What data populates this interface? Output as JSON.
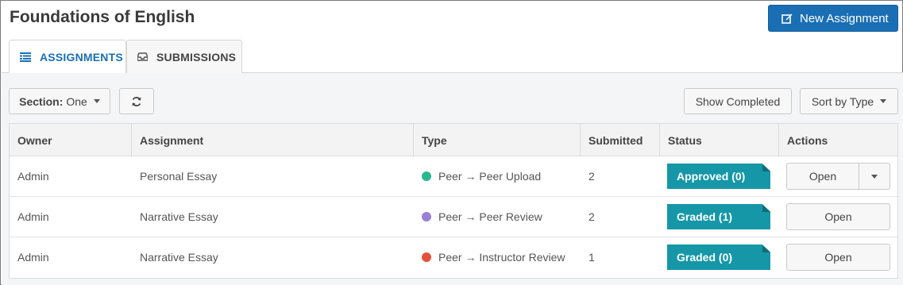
{
  "header": {
    "title": "Foundations of English",
    "new_button_label": "New Assignment"
  },
  "tabs": [
    {
      "label": "ASSIGNMENTS",
      "icon": "list-icon",
      "active": true
    },
    {
      "label": "SUBMISSIONS",
      "icon": "inbox-icon",
      "active": false
    }
  ],
  "toolbar": {
    "section_label": "Section:",
    "section_value": "One",
    "refresh_icon": "refresh-icon",
    "show_completed_label": "Show Completed",
    "sort_label": "Sort by Type"
  },
  "table": {
    "columns": [
      "Owner",
      "Assignment",
      "Type",
      "Submitted",
      "Status",
      "Actions"
    ],
    "rows": [
      {
        "owner": "Admin",
        "assignment": "Personal Essay",
        "type": "Peer → Peer Upload",
        "type_color": "#2bb891",
        "submitted": "2",
        "status": "Approved (0)",
        "action": "Open",
        "has_dropdown": true
      },
      {
        "owner": "Admin",
        "assignment": "Narrative Essay",
        "type": "Peer → Peer Review",
        "type_color": "#9a7fd6",
        "submitted": "2",
        "status": "Graded (1)",
        "action": "Open",
        "has_dropdown": false
      },
      {
        "owner": "Admin",
        "assignment": "Narrative Essay",
        "type": "Peer → Instructor Review",
        "type_color": "#e4523d",
        "submitted": "1",
        "status": "Graded (0)",
        "action": "Open",
        "has_dropdown": false
      }
    ]
  },
  "colors": {
    "primary": "#1a6fb4",
    "status": "#1597a8"
  }
}
